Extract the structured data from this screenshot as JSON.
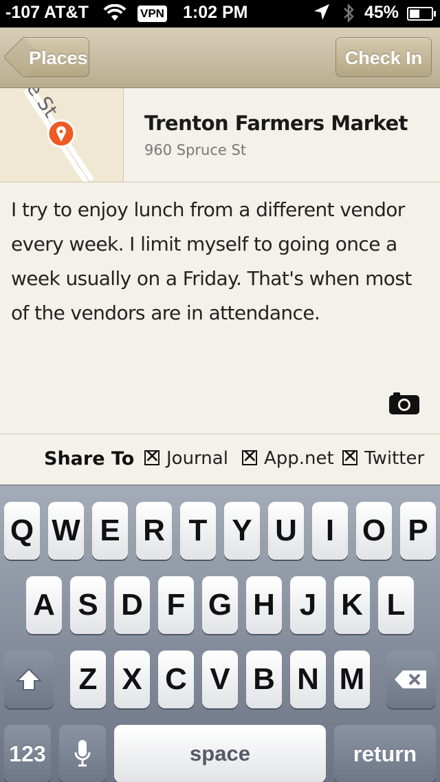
{
  "status_bar": {
    "carrier": "-107 AT&T",
    "vpn": "VPN",
    "time": "1:02 PM",
    "battery": "45%"
  },
  "nav": {
    "back_label": "Places",
    "checkin_label": "Check In"
  },
  "place": {
    "name": "Trenton Farmers Market",
    "address": "960 Spruce St",
    "map_street_label": "e St"
  },
  "note": {
    "text": "I try to enjoy lunch from a different vendor every week. I limit myself to going once a week usually on a Friday. That's when most of the vendors are in attendance."
  },
  "share": {
    "label": "Share To",
    "options": [
      {
        "label": "Journal",
        "checked": true
      },
      {
        "label": "App.net",
        "checked": true
      },
      {
        "label": "Twitter",
        "checked": true
      }
    ]
  },
  "keyboard": {
    "row1": [
      "Q",
      "W",
      "E",
      "R",
      "T",
      "Y",
      "U",
      "I",
      "O",
      "P"
    ],
    "row2": [
      "A",
      "S",
      "D",
      "F",
      "G",
      "H",
      "J",
      "K",
      "L"
    ],
    "row3": [
      "Z",
      "X",
      "C",
      "V",
      "B",
      "N",
      "M"
    ],
    "numbers_label": "123",
    "space_label": "space",
    "return_label": "return"
  },
  "colors": {
    "navbar": "#c8bda0",
    "map_pin": "#ef5a24",
    "page_bg": "#f4f1ea"
  }
}
